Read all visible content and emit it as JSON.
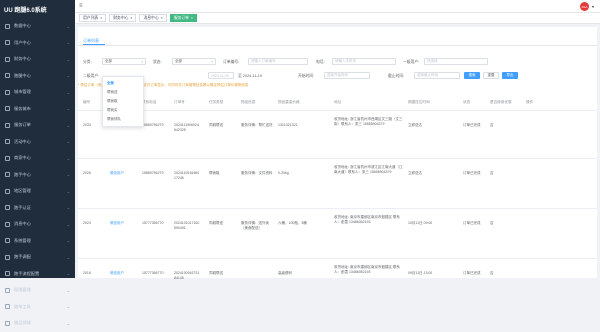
{
  "app": {
    "title": "UU 跑腿6.0系统",
    "user_avatar": "SSA"
  },
  "sidebar": {
    "items": [
      {
        "label": "数据中心",
        "icon": "chart-icon"
      },
      {
        "label": "用户中心",
        "icon": "user-icon"
      },
      {
        "label": "财务中心",
        "icon": "wallet-icon"
      },
      {
        "label": "跑腿中心",
        "icon": "runner-icon"
      },
      {
        "label": "城市管理",
        "icon": "city-icon"
      },
      {
        "label": "服务城市",
        "icon": "location-icon"
      },
      {
        "label": "服务订单",
        "icon": "order-icon"
      },
      {
        "label": "活动中心",
        "icon": "gift-icon"
      },
      {
        "label": "商家中心",
        "icon": "shop-icon"
      },
      {
        "label": "跑手中心",
        "icon": "rider-icon"
      },
      {
        "label": "地区管理",
        "icon": "map-icon"
      },
      {
        "label": "跑手认证",
        "icon": "badge-icon"
      },
      {
        "label": "消息中心",
        "icon": "bell-icon"
      },
      {
        "label": "系统管理",
        "icon": "gear-icon"
      },
      {
        "label": "跑手调配",
        "icon": "sync-icon"
      },
      {
        "label": "跑手流程配置",
        "icon": "flow-icon"
      },
      {
        "label": "权限管理",
        "icon": "lock-icon"
      },
      {
        "label": "跑单工具",
        "icon": "tool-icon"
      },
      {
        "label": "物品领域",
        "icon": "box-icon"
      }
    ]
  },
  "tabs": [
    {
      "label": "用户列表",
      "active": false
    },
    {
      "label": "财务中心",
      "active": false
    },
    {
      "label": "消息中心",
      "active": false
    },
    {
      "label": "服务订单",
      "active": true
    }
  ],
  "subtab": "订单列表",
  "filters": {
    "category_label": "分类:",
    "category_value": "全部",
    "status_label": "状态:",
    "status_value": "全部",
    "order_no_label": "订单编号:",
    "order_no_placeholder": "请输入订单编号",
    "phone_label": "电话:",
    "phone_placeholder": "请输入手机号",
    "runner_label": "一级用户:",
    "runner_placeholder": "请选择",
    "second_label": "二级用户:",
    "date_value": "2024-11-05",
    "date_to": "至 2024-11-19",
    "start_label": "开始时间:",
    "start_placeholder": "选择开始时间",
    "end_label": "截止时间:",
    "end_placeholder": "选择截止时间",
    "search_btn": "搜索",
    "reset_btn": "重置",
    "export_btn": "导出"
  },
  "warning": "* 预估订单（系统自动推送的订单）非实际支付订单显示，可同时在订单管理处查看以确定预估订单价格等信息",
  "dropdown": {
    "items": [
      "全部",
      "帮我送",
      "帮我取",
      "帮我买",
      "帮我排队"
    ],
    "selected": 0
  },
  "table": {
    "headers": [
      "编号",
      "用户",
      "联系电话",
      "订单号",
      "任务类型",
      "物品信息",
      "物品重量价格",
      "地址",
      "期望送达时间",
      "状态",
      "是否使用优惠",
      "操作"
    ],
    "rows": [
      {
        "id": "2033",
        "user": "微信用户",
        "phone": "15869756279",
        "order": "2024111906024 642325",
        "type": "同城帮送",
        "goods": "服务详情：帮忙送货",
        "weight": "1321321321",
        "address": "收货地址: 浙江省杭州市西湖区文三路（文三街）联系人：张三 15658904379",
        "expect": "立即送达",
        "status": "订单已完成",
        "coupon": "否"
      },
      {
        "id": "2026",
        "user": "微信用户",
        "phone": "15869756279",
        "order": "2024110516484 17246",
        "type": "帮我取",
        "goods": "服务详情：文件资料",
        "weight": "0-20kg",
        "address": "收货地址: 浙江省杭州市滨江区江南大道（江南大道）联系人：张三 15658904379",
        "expect": "立即送达",
        "status": "订单已完成",
        "coupon": "否"
      },
      {
        "id": "2024",
        "user": "微信用户",
        "phone": "15777366770",
        "order": "2024101017160 590491",
        "type": "同城帮送",
        "goods": "服务详情：送外卖（美食配送）",
        "weight": "六桶，100瓶，3桶",
        "address": "收货地址: 南京市建邺区南京市鼓楼区 联系人：彭霞 13486052193",
        "expect": "10月11日 09:00",
        "status": "订单已完成",
        "coupon": "否"
      },
      {
        "id": "2016",
        "user": "微信用户",
        "phone": "15777366770",
        "order": "2024100916731 84145",
        "type": "同城帮送",
        "goods": "",
        "weight": "高级便利",
        "address": "收货地址: 南京市建邺区南京市鼓楼区 联系人：彭霞 13486052193",
        "expect": "09月11日 13:00",
        "status": "订单已完成",
        "coupon": "否"
      }
    ]
  }
}
